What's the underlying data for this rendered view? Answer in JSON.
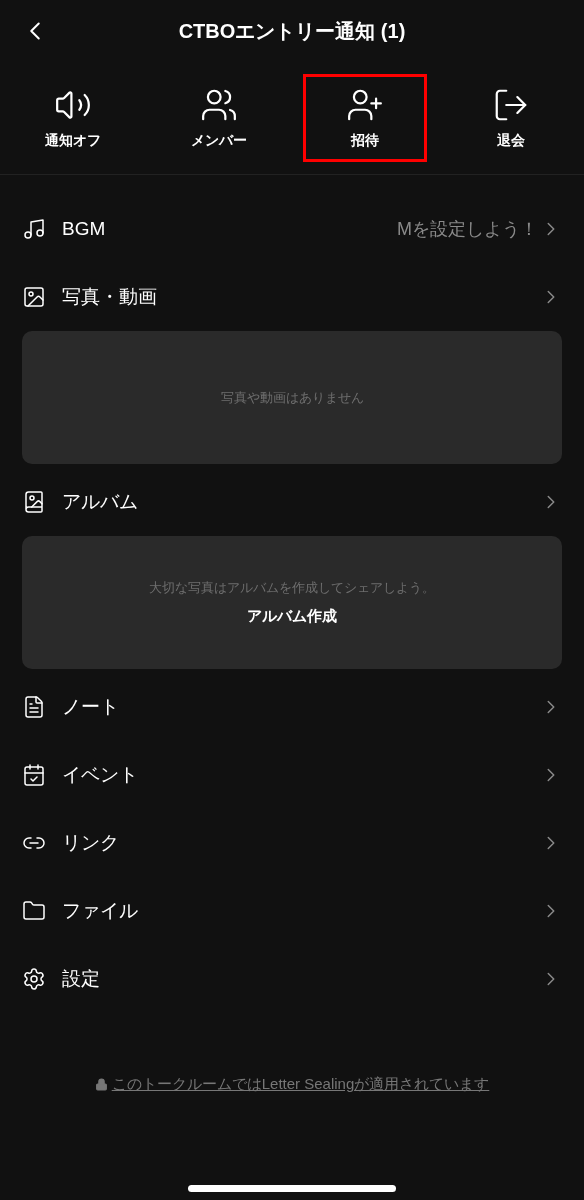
{
  "header": {
    "title": "CTBOエントリー通知 (1)"
  },
  "actions": [
    {
      "label": "通知オフ",
      "highlighted": false
    },
    {
      "label": "メンバー",
      "highlighted": false
    },
    {
      "label": "招待",
      "highlighted": true
    },
    {
      "label": "退会",
      "highlighted": false
    }
  ],
  "menu": [
    {
      "label": "BGM",
      "value": "Mを設定しよう！"
    },
    {
      "label": "写真・動画",
      "card": {
        "text": "写真や動画はありません"
      }
    },
    {
      "label": "アルバム",
      "card": {
        "text": "大切な写真はアルバムを作成してシェアしよう。",
        "action": "アルバム作成"
      }
    },
    {
      "label": "ノート"
    },
    {
      "label": "イベント"
    },
    {
      "label": "リンク"
    },
    {
      "label": "ファイル"
    },
    {
      "label": "設定"
    }
  ],
  "footer": {
    "notice": "このトークルームではLetter Sealingが適用されています"
  }
}
